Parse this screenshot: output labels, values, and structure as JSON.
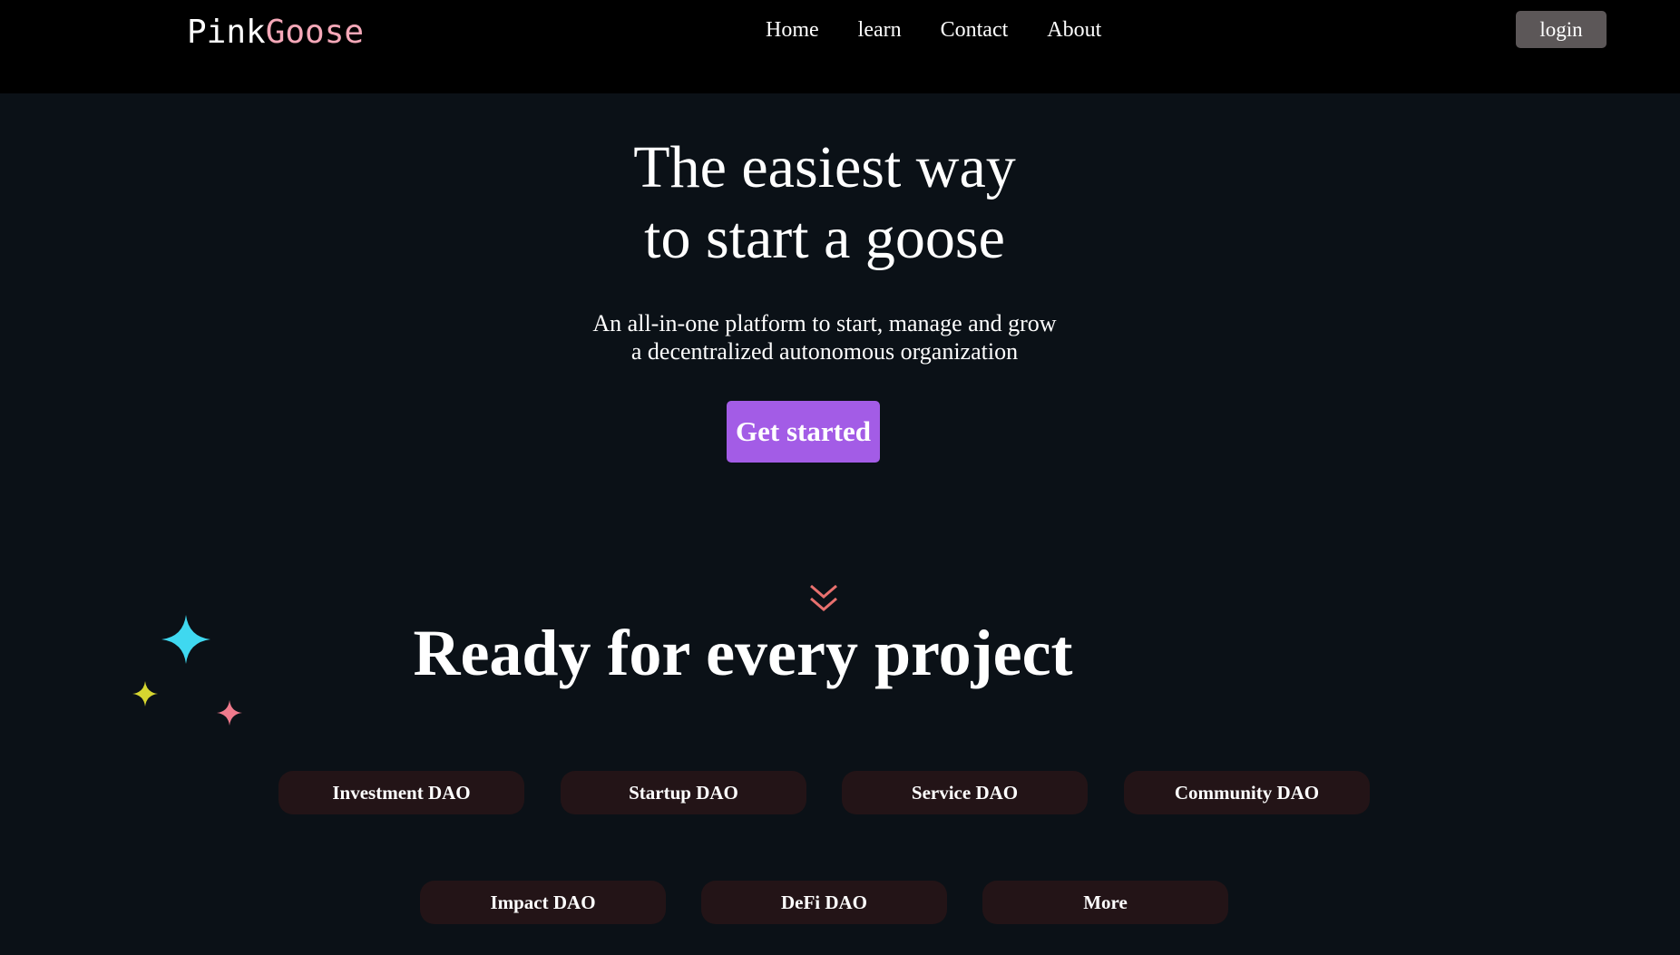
{
  "brand": {
    "part1": "Pink",
    "part2": "Goose",
    "color_part2": "#f5a8b8"
  },
  "nav": {
    "links": [
      "Home",
      "learn",
      "Contact",
      "About"
    ],
    "login_label": "login"
  },
  "hero": {
    "title_line1": "The easiest way",
    "title_line2": "to start a goose",
    "subtitle_line1": "An all-in-one platform to start, manage and grow",
    "subtitle_line2": "a decentralized autonomous organization",
    "cta_label": "Get started",
    "cta_color": "#a35ce6"
  },
  "scroll_icon": "chevron-double-down-icon",
  "section": {
    "title": "Ready for every project",
    "categories": [
      "Investment DAO",
      "Startup DAO",
      "Service DAO",
      "Community DAO",
      "Impact DAO",
      "DeFi DAO",
      "More"
    ]
  },
  "sparkles": [
    {
      "name": "cyan-sparkle-icon",
      "color": "#3fd8f0"
    },
    {
      "name": "yellow-sparkle-icon",
      "color": "#d6d630"
    },
    {
      "name": "pink-sparkle-icon",
      "color": "#f07a8c"
    }
  ]
}
